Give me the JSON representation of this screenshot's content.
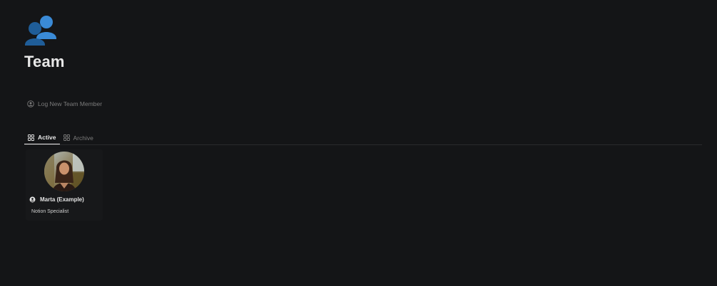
{
  "page": {
    "icon": "team-people-icon",
    "title": "Team"
  },
  "actions": {
    "log_new_member": {
      "label": "Log New Team Member",
      "icon": "person-circle-icon"
    }
  },
  "tabs": [
    {
      "label": "Active",
      "icon": "gallery-grid-icon",
      "selected": true
    },
    {
      "label": "Archive",
      "icon": "gallery-grid-icon",
      "selected": false
    }
  ],
  "cards": [
    {
      "name": "Marta (Example)",
      "name_icon": "person-circle-icon",
      "role": "Notion Specialist",
      "avatar": "profile-photo"
    }
  ],
  "colors": {
    "background": "#141517",
    "icon_blue_dark": "#1f5d98",
    "icon_blue_light": "#3a8ad6",
    "text_primary": "#e8e8e8",
    "text_muted": "#7c7c7c"
  }
}
